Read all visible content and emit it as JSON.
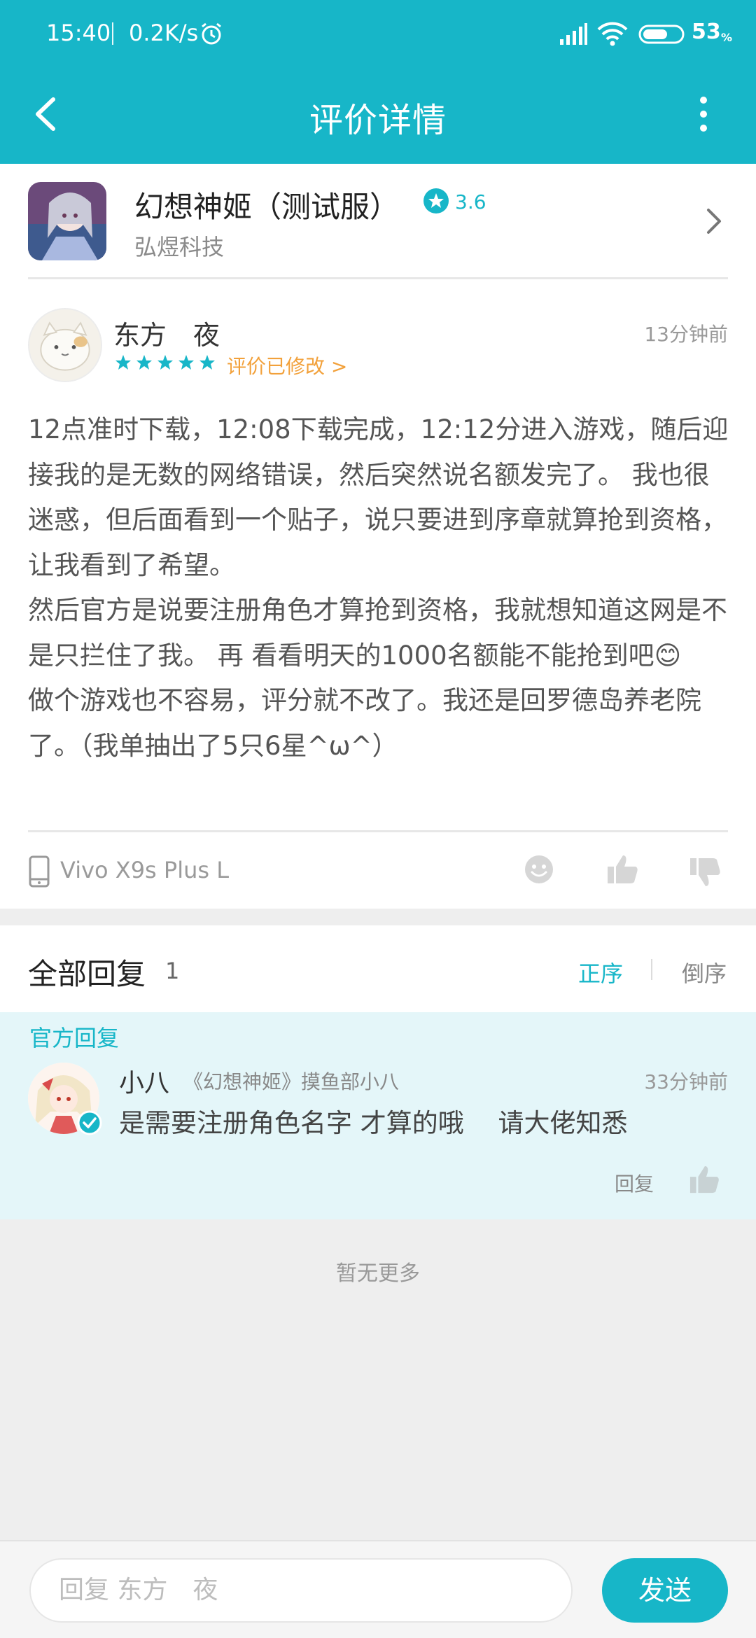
{
  "status_bar": {
    "time": "15:40",
    "net_speed": "0.2K/s",
    "battery": "53",
    "battery_unit": "%"
  },
  "title_bar": {
    "title": "评价详情"
  },
  "game": {
    "title": "幻想神姬（测试服）",
    "rating": "3.6",
    "publisher": "弘煜科技"
  },
  "review": {
    "username": "东方　夜",
    "stars": 5,
    "modified_link": "评价已修改 >",
    "time": "13分钟前",
    "body": "12点准时下载，12:08下载完成，12:12分进入游戏，随后迎接我的是无数的网络错误，然后突然说名额发完了。 我也很迷惑，但后面看到一个贴子，说只要进到序章就算抢到资格，让我看到了希望。\n然后官方是说要注册角色才算抢到资格，我就想知道这网是不是只拦住了我。 再 看看明天的1000名额能不能抢到吧😊\n做个游戏也不容易，评分就不改了。我还是回罗德岛养老院了。（我单抽出了5只6星^ω^）",
    "device": "Vivo X9s Plus L"
  },
  "replies": {
    "title": "全部回复",
    "count": "1",
    "sort_asc": "正序",
    "sort_desc": "倒序"
  },
  "official_reply": {
    "label": "官方回复",
    "user": "小八",
    "role": "《幻想神姬》摸鱼部小八",
    "time": "33分钟前",
    "text": "是需要注册角色名字 才算的哦　 请大佬知悉",
    "reply_button": "回复"
  },
  "no_more": "暂无更多",
  "input_bar": {
    "placeholder": "回复 东方　夜",
    "send_label": "发送"
  },
  "colors": {
    "accent": "#17b6c8",
    "modified": "#f2a13b",
    "official_bg": "#e4f6f9"
  }
}
